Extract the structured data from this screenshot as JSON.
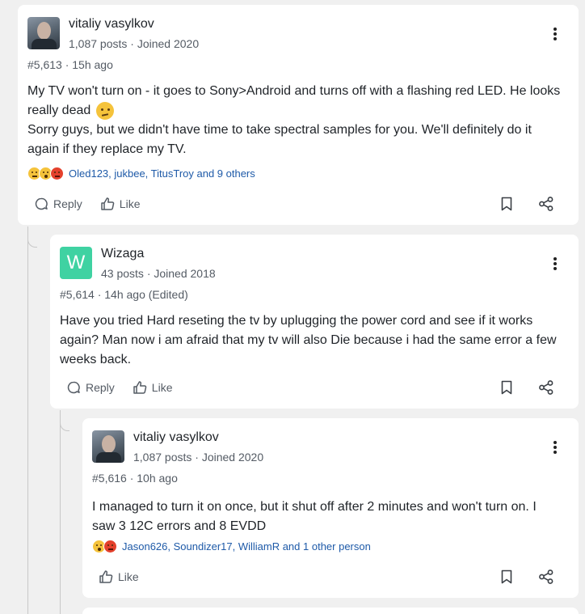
{
  "posts": [
    {
      "username": "vitaliy vasylkov",
      "meta": "1,087 posts · Joined 2020",
      "post_id": "#5,613 · 15h ago",
      "content_lines": [
        "My TV won't turn on - it goes to Sony>Android and turns off with a flashing red LED. He looks really dead",
        "Sorry guys, but we didn't have time to take spectral samples for you. We'll definitely do it again if they replace my TV."
      ],
      "reactions_text": "Oled123, jukbee, TitusTroy and 9 others",
      "reply_label": "Reply",
      "like_label": "Like"
    },
    {
      "username": "Wizaga",
      "avatar_letter": "W",
      "meta": "43 posts · Joined 2018",
      "post_id": "#5,614 · 14h ago (Edited)",
      "content": "Have you tried Hard reseting the tv by uplugging the power cord and see if it works again? Man now i am afraid that my tv will also Die because i had the same error a few weeks back.",
      "reply_label": "Reply",
      "like_label": "Like"
    },
    {
      "username": "vitaliy vasylkov",
      "meta": "1,087 posts · Joined 2020",
      "post_id": "#5,616 · 10h ago",
      "content": "I managed to turn it on once, but it shut off after 2 minutes and won't turn on. I saw 3 12C errors and 8 EVDD",
      "reactions_text": "Jason626, Soundizer17, WilliamR and 1 other person",
      "like_label": "Like"
    }
  ],
  "colors": {
    "link": "#1e5aa8",
    "wizaga_avatar": "#3fd2a2"
  }
}
